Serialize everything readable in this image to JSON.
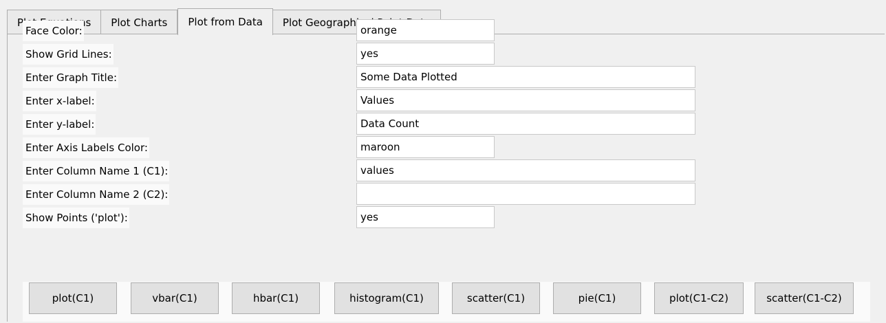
{
  "tabs": [
    {
      "label": "Plot Equations"
    },
    {
      "label": "Plot Charts"
    },
    {
      "label": "Plot from Data"
    },
    {
      "label": "Plot Geographical Point Data"
    }
  ],
  "form": {
    "fields": [
      {
        "label": "Face Color:",
        "value": "orange"
      },
      {
        "label": "Show Grid Lines:",
        "value": "yes"
      },
      {
        "label": "Enter Graph Title:",
        "value": "Some Data Plotted"
      },
      {
        "label": "Enter x-label:",
        "value": "Values"
      },
      {
        "label": "Enter y-label:",
        "value": "Data Count"
      },
      {
        "label": "Enter Axis Labels Color:",
        "value": "maroon"
      },
      {
        "label": "Enter Column Name 1 (C1):",
        "value": "values"
      },
      {
        "label": "Enter Column Name 2 (C2):",
        "value": ""
      },
      {
        "label": "Show Points ('plot'):",
        "value": "yes"
      }
    ]
  },
  "buttons": [
    {
      "label": "plot(C1)"
    },
    {
      "label": "vbar(C1)"
    },
    {
      "label": "hbar(C1)"
    },
    {
      "label": "histogram(C1)"
    },
    {
      "label": "scatter(C1)"
    },
    {
      "label": "pie(C1)"
    },
    {
      "label": "plot(C1-C2)"
    },
    {
      "label": "scatter(C1-C2)"
    }
  ]
}
